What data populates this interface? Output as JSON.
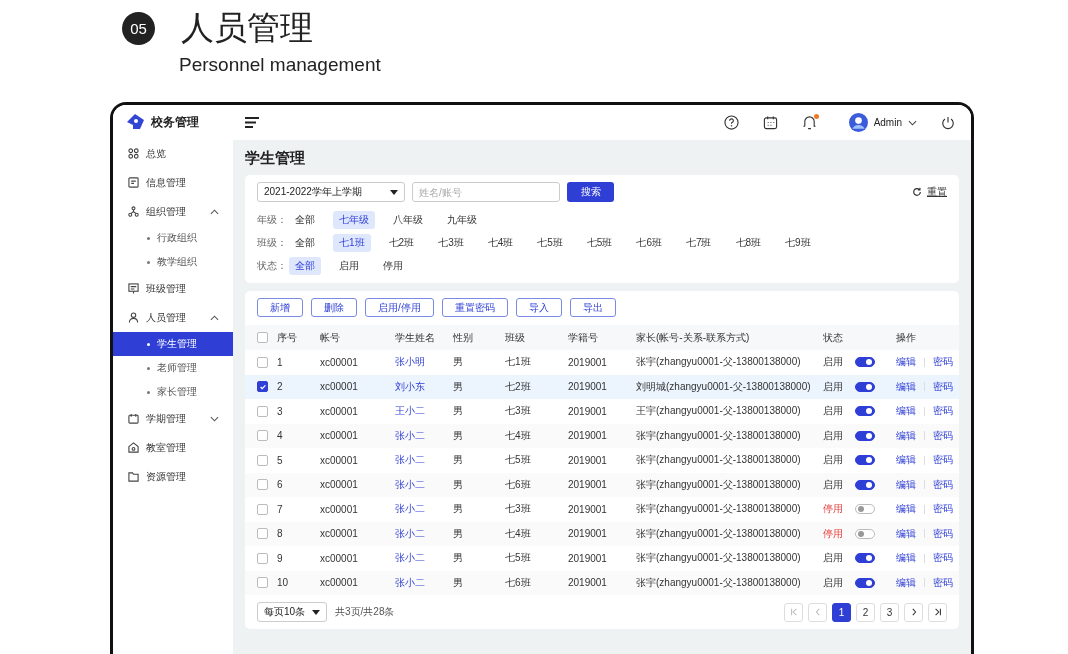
{
  "header": {
    "badge": "05",
    "title": "人员管理",
    "subtitle": "Personnel management"
  },
  "app": {
    "logo": "校务管理",
    "sidebar": [
      {
        "label": "总览",
        "selected": false
      },
      {
        "label": "信息管理",
        "selected": false
      },
      {
        "label": "组织管理",
        "selected": false,
        "expanded": true,
        "children": [
          {
            "label": "行政组织",
            "selected": false
          },
          {
            "label": "教学组织",
            "selected": false
          }
        ]
      },
      {
        "label": "班级管理",
        "selected": false
      },
      {
        "label": "人员管理",
        "selected": false,
        "expanded": true,
        "children": [
          {
            "label": "学生管理",
            "selected": true
          },
          {
            "label": "老师管理",
            "selected": false
          },
          {
            "label": "家长管理",
            "selected": false
          }
        ]
      },
      {
        "label": "学期管理",
        "selected": false,
        "expanded": false
      },
      {
        "label": "教室管理",
        "selected": false
      },
      {
        "label": "资源管理",
        "selected": false
      }
    ],
    "topbar": {
      "user": "Admin",
      "has_notification": true
    },
    "page_title": "学生管理",
    "filters": {
      "term": "2021-2022学年上学期",
      "search_placeholder": "姓名/账号",
      "search_button": "搜索",
      "reset": "重置",
      "groups": [
        {
          "label": "年级：",
          "options": [
            {
              "label": "全部",
              "selected": false
            },
            {
              "label": "七年级",
              "selected": true
            },
            {
              "label": "八年级",
              "selected": false
            },
            {
              "label": "九年级",
              "selected": false
            }
          ]
        },
        {
          "label": "班级：",
          "options": [
            {
              "label": "全部",
              "selected": false
            },
            {
              "label": "七1班",
              "selected": true
            },
            {
              "label": "七2班",
              "selected": false
            },
            {
              "label": "七3班",
              "selected": false
            },
            {
              "label": "七4班",
              "selected": false
            },
            {
              "label": "七5班",
              "selected": false
            },
            {
              "label": "七5班",
              "selected": false
            },
            {
              "label": "七6班",
              "selected": false
            },
            {
              "label": "七7班",
              "selected": false
            },
            {
              "label": "七8班",
              "selected": false
            },
            {
              "label": "七9班",
              "selected": false
            }
          ]
        },
        {
          "label": "状态：",
          "options": [
            {
              "label": "全部",
              "selected": true
            },
            {
              "label": "启用",
              "selected": false
            },
            {
              "label": "停用",
              "selected": false
            }
          ]
        }
      ]
    },
    "toolbar": [
      "新增",
      "删除",
      "启用/停用",
      "重置密码",
      "导入",
      "导出"
    ],
    "table": {
      "all_checked": false,
      "columns": [
        "序号",
        "帐号",
        "学生姓名",
        "性别",
        "班级",
        "学籍号",
        "家长(帐号-关系-联系方式)",
        "状态",
        "操作"
      ],
      "rows": [
        {
          "checked": false,
          "no": "1",
          "account": "xc00001",
          "name": "张小明",
          "gender": "男",
          "class": "七1班",
          "student_no": "2019001",
          "parent": "张宇(zhangyu0001-父-13800138000)",
          "status": "启用",
          "enabled": true,
          "actions": [
            "编辑",
            "密码"
          ]
        },
        {
          "checked": true,
          "no": "2",
          "account": "xc00001",
          "name": "刘小东",
          "gender": "男",
          "class": "七2班",
          "student_no": "2019001",
          "parent": "刘明城(zhangyu0001-父-13800138000)",
          "status": "启用",
          "enabled": true,
          "actions": [
            "编辑",
            "密码"
          ]
        },
        {
          "checked": false,
          "no": "3",
          "account": "xc00001",
          "name": "王小二",
          "gender": "男",
          "class": "七3班",
          "student_no": "2019001",
          "parent": "王宇(zhangyu0001-父-13800138000)",
          "status": "启用",
          "enabled": true,
          "actions": [
            "编辑",
            "密码"
          ]
        },
        {
          "checked": false,
          "no": "4",
          "account": "xc00001",
          "name": "张小二",
          "gender": "男",
          "class": "七4班",
          "student_no": "2019001",
          "parent": "张宇(zhangyu0001-父-13800138000)",
          "status": "启用",
          "enabled": true,
          "actions": [
            "编辑",
            "密码"
          ]
        },
        {
          "checked": false,
          "no": "5",
          "account": "xc00001",
          "name": "张小二",
          "gender": "男",
          "class": "七5班",
          "student_no": "2019001",
          "parent": "张宇(zhangyu0001-父-13800138000)",
          "status": "启用",
          "enabled": true,
          "actions": [
            "编辑",
            "密码"
          ]
        },
        {
          "checked": false,
          "no": "6",
          "account": "xc00001",
          "name": "张小二",
          "gender": "男",
          "class": "七6班",
          "student_no": "2019001",
          "parent": "张宇(zhangyu0001-父-13800138000)",
          "status": "启用",
          "enabled": true,
          "actions": [
            "编辑",
            "密码"
          ]
        },
        {
          "checked": false,
          "no": "7",
          "account": "xc00001",
          "name": "张小二",
          "gender": "男",
          "class": "七3班",
          "student_no": "2019001",
          "parent": "张宇(zhangyu0001-父-13800138000)",
          "status": "停用",
          "enabled": false,
          "actions": [
            "编辑",
            "密码"
          ]
        },
        {
          "checked": false,
          "no": "8",
          "account": "xc00001",
          "name": "张小二",
          "gender": "男",
          "class": "七4班",
          "student_no": "2019001",
          "parent": "张宇(zhangyu0001-父-13800138000)",
          "status": "停用",
          "enabled": false,
          "actions": [
            "编辑",
            "密码"
          ]
        },
        {
          "checked": false,
          "no": "9",
          "account": "xc00001",
          "name": "张小二",
          "gender": "男",
          "class": "七5班",
          "student_no": "2019001",
          "parent": "张宇(zhangyu0001-父-13800138000)",
          "status": "启用",
          "enabled": true,
          "actions": [
            "编辑",
            "密码"
          ]
        },
        {
          "checked": false,
          "no": "10",
          "account": "xc00001",
          "name": "张小二",
          "gender": "男",
          "class": "七6班",
          "student_no": "2019001",
          "parent": "张宇(zhangyu0001-父-13800138000)",
          "status": "启用",
          "enabled": true,
          "actions": [
            "编辑",
            "密码"
          ]
        }
      ]
    },
    "pagination": {
      "page_size": "每页10条",
      "summary": "共3页/共28条",
      "pages": [
        {
          "label": "1",
          "selected": true
        },
        {
          "label": "2",
          "selected": false
        },
        {
          "label": "3",
          "selected": false
        }
      ]
    }
  }
}
